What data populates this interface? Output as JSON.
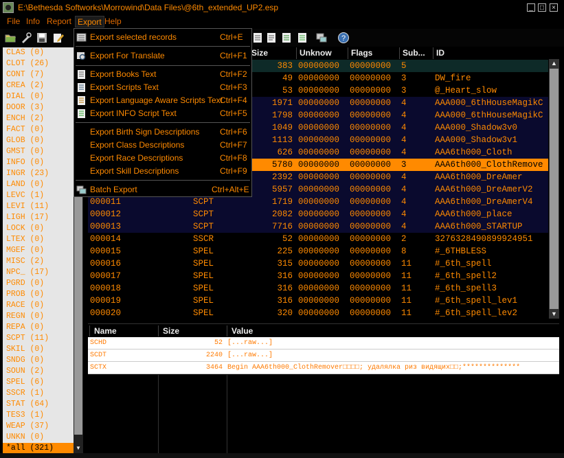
{
  "window": {
    "title": "E:\\Bethesda Softworks\\Morrowind\\Data Files\\@6th_extended_UP2.esp",
    "min": "_",
    "max": "□",
    "close": "×"
  },
  "menubar": [
    "File",
    "Info",
    "Report",
    "Export",
    "Help"
  ],
  "left_list": {
    "items": [
      "CLAS (0)",
      "CLOT (26)",
      "CONT (7)",
      "CREA (2)",
      "DIAL (0)",
      "DOOR (3)",
      "ENCH (2)",
      "FACT (0)",
      "GLOB (0)",
      "GMST (0)",
      "INFO (0)",
      "INGR (23)",
      "LAND (0)",
      "LEVC (1)",
      "LEVI (11)",
      "LIGH (17)",
      "LOCK (0)",
      "LTEX (0)",
      "MGEF (0)",
      "MISC (2)",
      "NPC_ (17)",
      "PGRD (0)",
      "PROB (0)",
      "RACE (0)",
      "REGN (0)",
      "REPA (0)",
      "SCPT (11)",
      "SKIL (0)",
      "SNDG (0)",
      "SOUN (2)",
      "SPEL (6)",
      "SSCR (1)",
      "STAT (64)",
      "TES3 (1)",
      "WEAP (37)",
      "UNKN (0)",
      "*all (321)"
    ]
  },
  "grid": {
    "headers": [
      "Size",
      "Unknow",
      "Flags",
      "Sub...",
      "ID"
    ],
    "rows": [
      {
        "num": "",
        "type": "",
        "size": "383",
        "unknow": "00000000",
        "flags": "00000000",
        "sub": "5",
        "id": ""
      },
      {
        "num": "",
        "type": "",
        "size": "49",
        "unknow": "00000000",
        "flags": "00000000",
        "sub": "3",
        "id": "DW_fire"
      },
      {
        "num": "",
        "type": "",
        "size": "53",
        "unknow": "00000000",
        "flags": "00000000",
        "sub": "3",
        "id": "@_Heart_slow"
      },
      {
        "num": "",
        "type": "",
        "size": "1971",
        "unknow": "00000000",
        "flags": "00000000",
        "sub": "4",
        "id": "AAA000_6thHouseMagikC"
      },
      {
        "num": "",
        "type": "",
        "size": "1798",
        "unknow": "00000000",
        "flags": "00000000",
        "sub": "4",
        "id": "AAA000_6thHouseMagikC"
      },
      {
        "num": "",
        "type": "",
        "size": "1049",
        "unknow": "00000000",
        "flags": "00000000",
        "sub": "4",
        "id": "AAA000_Shadow3v0"
      },
      {
        "num": "",
        "type": "",
        "size": "1113",
        "unknow": "00000000",
        "flags": "00000000",
        "sub": "4",
        "id": "AAA000_Shadow3v1"
      },
      {
        "num": "",
        "type": "",
        "size": "626",
        "unknow": "00000000",
        "flags": "00000000",
        "sub": "4",
        "id": "AAA6th000_Cloth"
      },
      {
        "num": "",
        "type": "",
        "size": "5780",
        "unknow": "00000000",
        "flags": "00000000",
        "sub": "3",
        "id": "AAA6th000_ClothRemove"
      },
      {
        "num": "",
        "type": "",
        "size": "2392",
        "unknow": "00000000",
        "flags": "00000000",
        "sub": "4",
        "id": "AAA6th000_DreAmer"
      },
      {
        "num": "",
        "type": "",
        "size": "5957",
        "unknow": "00000000",
        "flags": "00000000",
        "sub": "4",
        "id": "AAA6th000_DreAmerV2"
      },
      {
        "num": "000011",
        "type": "SCPT",
        "size": "1719",
        "unknow": "00000000",
        "flags": "00000000",
        "sub": "4",
        "id": "AAA6th000_DreAmerV4"
      },
      {
        "num": "000012",
        "type": "SCPT",
        "size": "2082",
        "unknow": "00000000",
        "flags": "00000000",
        "sub": "4",
        "id": "AAA6th000_place"
      },
      {
        "num": "000013",
        "type": "SCPT",
        "size": "7716",
        "unknow": "00000000",
        "flags": "00000000",
        "sub": "4",
        "id": "AAA6th000_STARTUP"
      },
      {
        "num": "000014",
        "type": "SSCR",
        "size": "52",
        "unknow": "00000000",
        "flags": "00000000",
        "sub": "2",
        "id": "3276328490899924951"
      },
      {
        "num": "000015",
        "type": "SPEL",
        "size": "225",
        "unknow": "00000000",
        "flags": "00000000",
        "sub": "8",
        "id": "#_6THBLESS"
      },
      {
        "num": "000016",
        "type": "SPEL",
        "size": "315",
        "unknow": "00000000",
        "flags": "00000000",
        "sub": "11",
        "id": "#_6th_spell"
      },
      {
        "num": "000017",
        "type": "SPEL",
        "size": "316",
        "unknow": "00000000",
        "flags": "00000000",
        "sub": "11",
        "id": "#_6th_spell2"
      },
      {
        "num": "000018",
        "type": "SPEL",
        "size": "316",
        "unknow": "00000000",
        "flags": "00000000",
        "sub": "11",
        "id": "#_6th_spell3"
      },
      {
        "num": "000019",
        "type": "SPEL",
        "size": "316",
        "unknow": "00000000",
        "flags": "00000000",
        "sub": "11",
        "id": "#_6th_spell_lev1"
      },
      {
        "num": "000020",
        "type": "SPEL",
        "size": "320",
        "unknow": "00000000",
        "flags": "00000000",
        "sub": "11",
        "id": "#_6th_spell_lev2"
      }
    ]
  },
  "detail": {
    "headers": [
      "Name",
      "Size",
      "Value"
    ],
    "rows": [
      {
        "name": "SCHD",
        "size": "52",
        "value": "[...raw...]"
      },
      {
        "name": "SCDT",
        "size": "2240",
        "value": "[...raw...]"
      },
      {
        "name": "SCTX",
        "size": "3464",
        "value": "Begin AAA6th000_ClothRemover□□□□; удалялка риз видящих□□;**************"
      }
    ]
  },
  "export_menu": [
    {
      "label": "Export selected records",
      "shortcut": "Ctrl+E"
    },
    {
      "label": "Export For Translate",
      "shortcut": "Ctrl+F1"
    },
    {
      "label": "Export Books Text",
      "shortcut": "Ctrl+F2"
    },
    {
      "label": "Export Scripts Text",
      "shortcut": "Ctrl+F3"
    },
    {
      "label": "Export Language Aware Scripts Text",
      "shortcut": "Ctrl+F4"
    },
    {
      "label": "Export INFO Script Text",
      "shortcut": "Ctrl+F5"
    },
    {
      "label": "Export Birth Sign Descriptions",
      "shortcut": "Ctrl+F6"
    },
    {
      "label": "Export Class Descriptions",
      "shortcut": "Ctrl+F7"
    },
    {
      "label": "Export Race Descriptions",
      "shortcut": "Ctrl+F8"
    },
    {
      "label": "Export Skill Descriptions",
      "shortcut": "Ctrl+F9"
    },
    {
      "label": "Batch Export",
      "shortcut": "Ctrl+Alt+E"
    }
  ],
  "colors": {
    "accent": "#ff8a00",
    "selected_row": "#ff8a00",
    "highlight_row": "#0a0a2e",
    "first_row": "#0e2a28"
  },
  "icons": [
    "open-icon",
    "tools-icon",
    "save-icon",
    "edit-icon",
    "document-icon",
    "text-icon",
    "network-icon",
    "help-icon"
  ]
}
